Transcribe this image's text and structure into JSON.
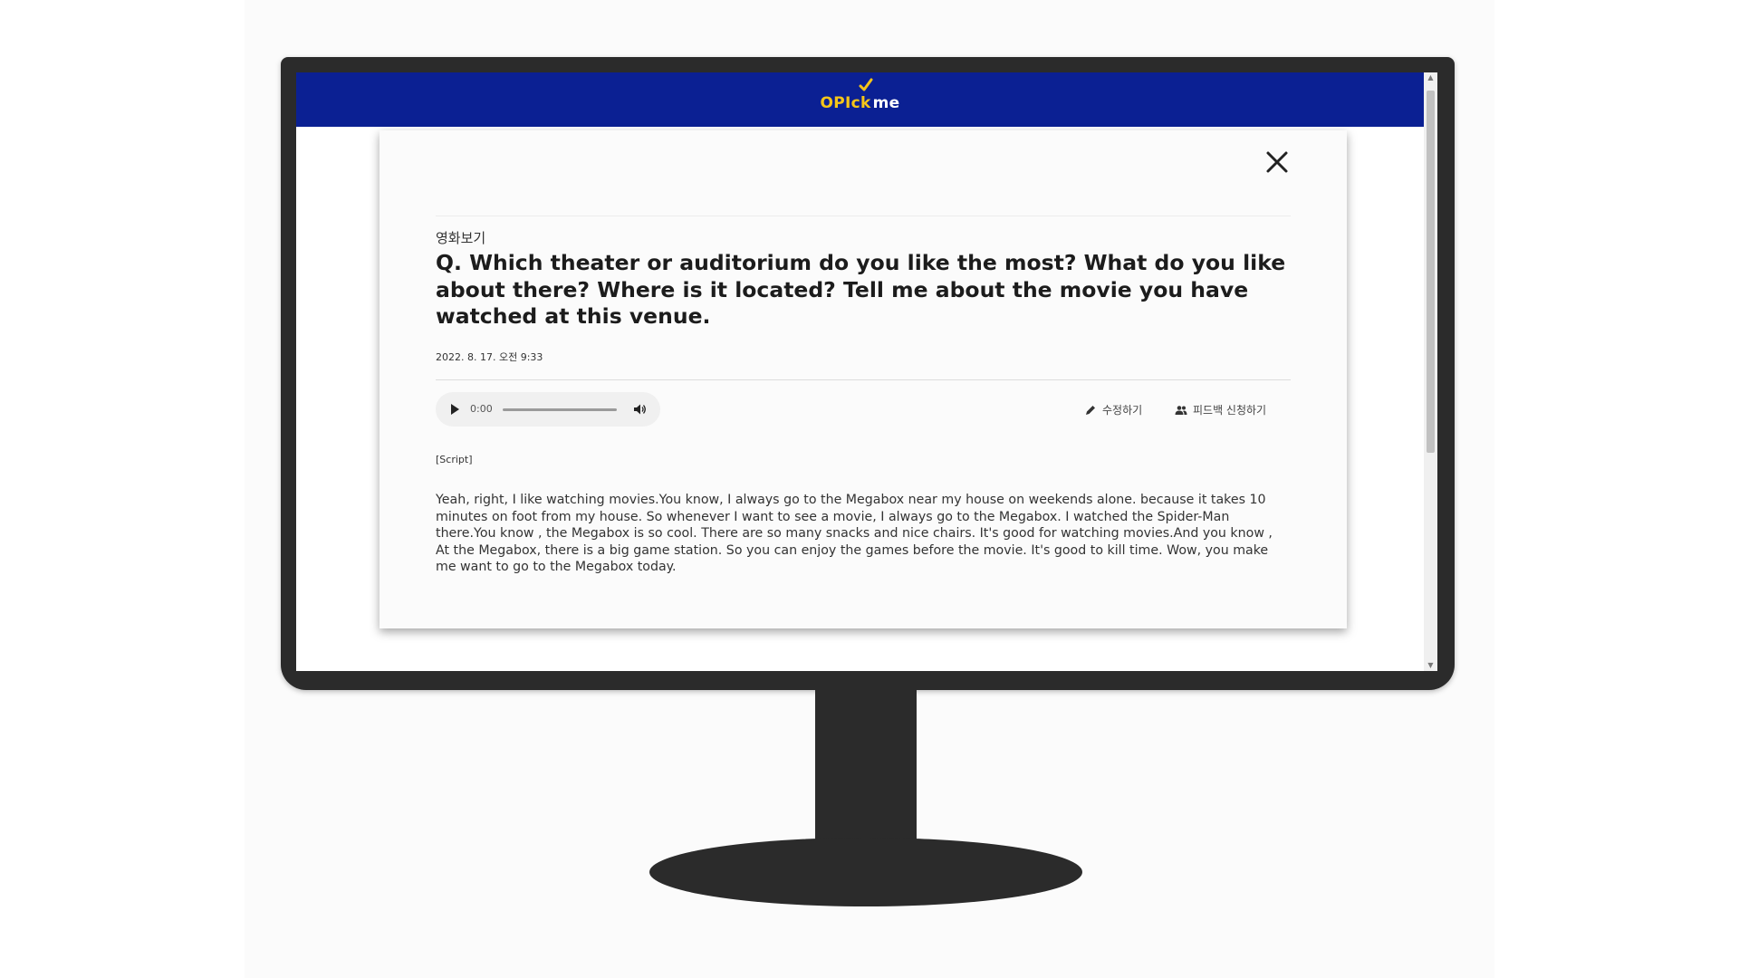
{
  "app": {
    "logo_part1": "OPIck",
    "logo_part2": "me",
    "brand_color": "#0b2093",
    "accent_color": "#f5c518"
  },
  "modal": {
    "close_icon": "close-icon",
    "category": "영화보기",
    "question": "Q. Which theater or auditorium do you like the most? What do you like about there? Where is it located? Tell me about the movie you have watched at this venue.",
    "date": "2022. 8. 17. 오전 9:33",
    "audio": {
      "current_time": "0:00",
      "progress": 0,
      "play_icon": "play-icon",
      "volume_icon": "volume-icon"
    },
    "actions": {
      "edit_label": "수정하기",
      "edit_icon": "pencil-icon",
      "feedback_label": "피드백 신청하기",
      "feedback_icon": "users-icon"
    },
    "script_label": "[Script]",
    "script_text": "Yeah, right, I like watching movies.You know, I always go to the Megabox near my house on weekends alone. because it takes 10 minutes on foot from my house. So whenever I want to see a movie, I always go to the Megabox. I watched the Spider-Man there.You know , the Megabox is so cool. There are so many snacks and nice chairs. It's good for watching movies.And you know , At the Megabox, there is a big game station. So you can enjoy the games before the movie. It's good to kill time. Wow, you make me want to go to the Megabox today."
  }
}
